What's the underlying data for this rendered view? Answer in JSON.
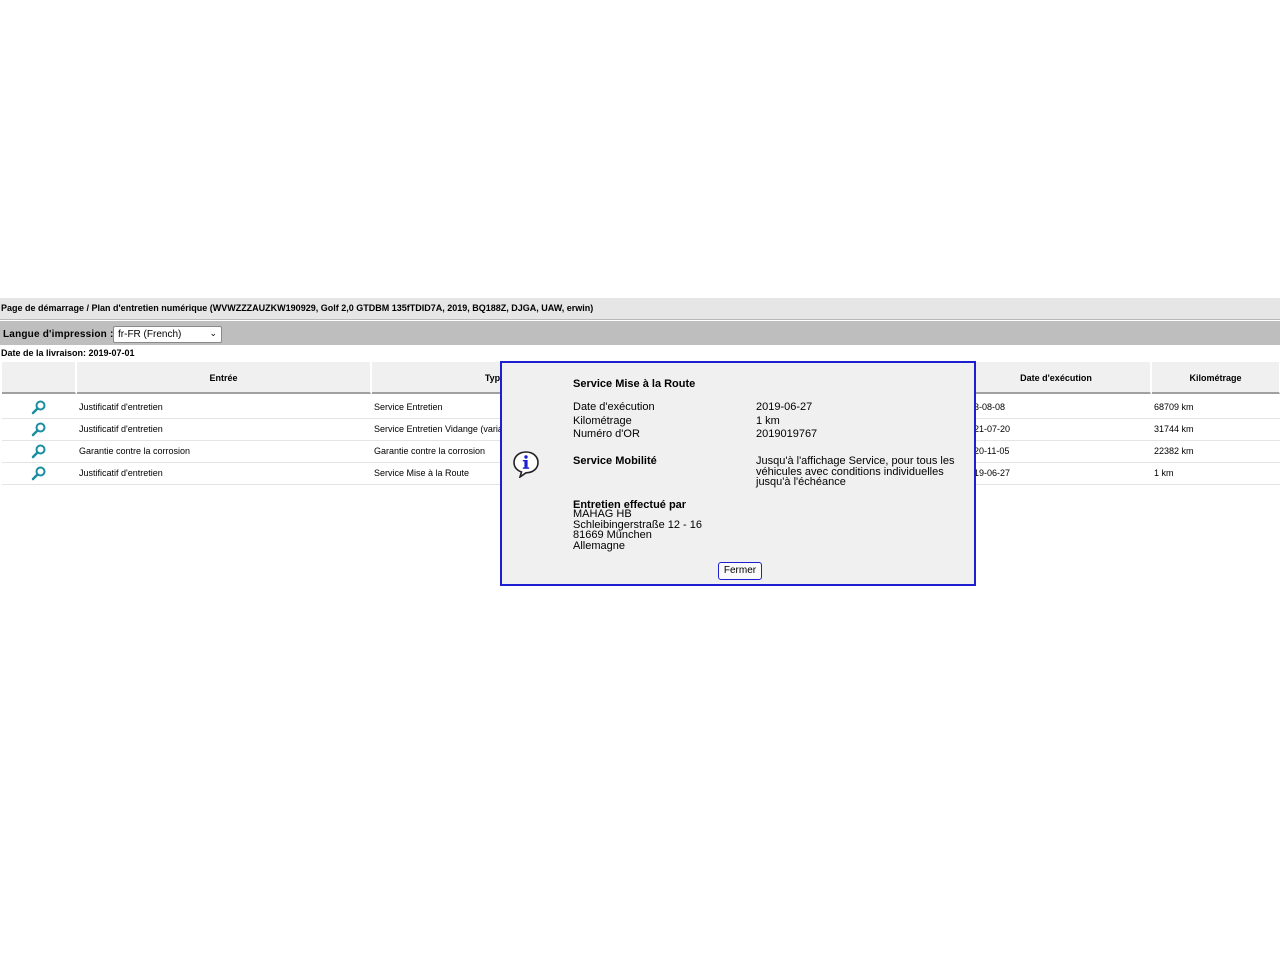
{
  "breadcrumb": "Page de démarrage / Plan d'entretien numérique (WVWZZZAUZKW190929, Golf 2,0 GTDBM 135fTDID7A, 2019, BQ188Z, DJGA, UAW, erwin)",
  "language": {
    "label": "Langue d'impression :",
    "selected": "fr-FR (French)"
  },
  "delivery_date": "Date de la livraison: 2019-07-01",
  "table": {
    "headers": {
      "entry": "Entrée",
      "type": "Typ",
      "exec_date": "Date d'exécution",
      "mileage": "Kilométrage"
    },
    "rows": [
      {
        "entry": "Justificatif d'entretien",
        "type": "Service Entretien",
        "date": "3-08-08",
        "km": "68709 km"
      },
      {
        "entry": "Justificatif d'entretien",
        "type": "Service Entretien Vidange (variab",
        "date": "21-07-20",
        "km": "31744 km"
      },
      {
        "entry": "Garantie contre la corrosion",
        "type": "Garantie contre la corrosion",
        "date": "20-11-05",
        "km": "22382 km"
      },
      {
        "entry": "Justificatif d'entretien",
        "type": "Service Mise à la Route",
        "date": "19-06-27",
        "km": "1 km"
      }
    ]
  },
  "dialog": {
    "title": "Service Mise à la Route",
    "fields": [
      {
        "label": "Date d'exécution",
        "value": "2019-06-27"
      },
      {
        "label": "Kilométrage",
        "value": "1 km"
      },
      {
        "label": "Numéro d'OR",
        "value": "2019019767"
      }
    ],
    "mobility_label": "Service Mobilité",
    "mobility_text": "Jusqu'à l'affichage Service, pour tous les véhicules avec conditions individuelles jusqu'à l'échéance",
    "performed_by_label": "Entretien effectué par",
    "address": [
      "MAHAG HB",
      "Schleibingerstraße 12 - 16",
      "81669 München",
      "Allemagne"
    ],
    "close_label": "Fermer"
  },
  "colors": {
    "dialog_border": "#1e1ed2",
    "magnifier": "#1a8ea0"
  }
}
